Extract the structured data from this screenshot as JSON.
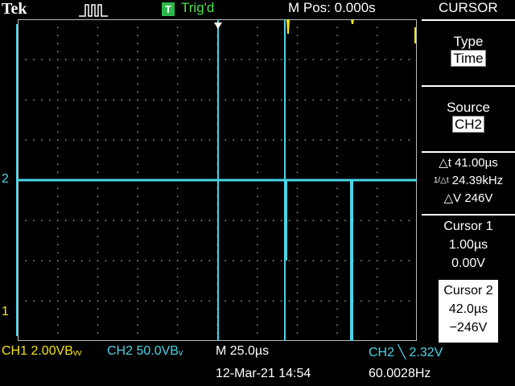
{
  "top": {
    "brand": "Tek",
    "trigger_badge": "T",
    "trigger_state": "Trig'd",
    "horizontal_position": "M Pos: 0.000s",
    "menu_title": "CURSOR"
  },
  "menu": {
    "type_label": "Type",
    "type_value": "Time",
    "source_label": "Source",
    "source_value": "CH2",
    "delta_t": "△t 41.00µs",
    "inv_delta_t": "24.39kHz",
    "delta_v": "△V 246V",
    "cursor1_label": "Cursor 1",
    "cursor1_time": "1.00µs",
    "cursor1_value": "0.00V",
    "cursor2_label": "Cursor 2",
    "cursor2_time": "42.0µs",
    "cursor2_value": "−246V"
  },
  "markers": {
    "ch2_marker": "2",
    "ch1_marker": "1"
  },
  "status": {
    "ch1_scale": "CH1  2.00VBᵥᵥ",
    "ch2_scale": "CH2  50.0VBᵥ",
    "timebase": "M 25.0µs",
    "trigger_info": "CH2 ╲ 2.32V",
    "date_time": "12-Mar-21 14:54",
    "frequency": "60.0028Hz"
  },
  "colors": {
    "ch1": "#f5e21b",
    "ch2": "#4ad4e8",
    "trigger": "#2db84c"
  }
}
